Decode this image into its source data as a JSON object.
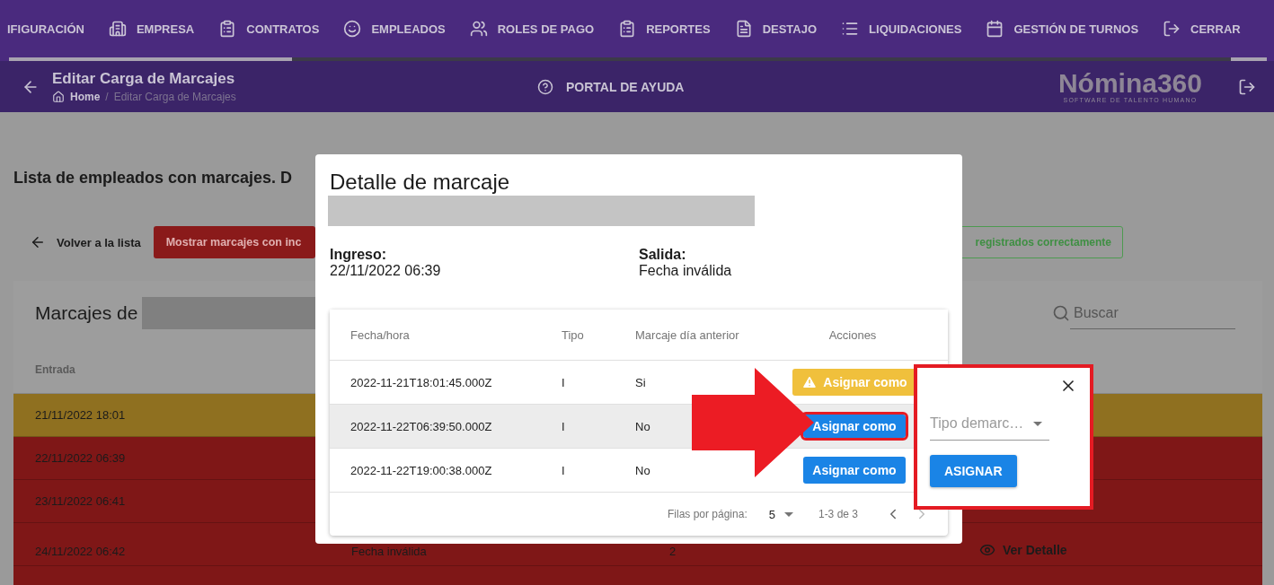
{
  "nav": {
    "items": [
      {
        "label": "IFIGURACIÓN"
      },
      {
        "label": "EMPRESA"
      },
      {
        "label": "CONTRATOS"
      },
      {
        "label": "EMPLEADOS"
      },
      {
        "label": "ROLES DE PAGO"
      },
      {
        "label": "REPORTES"
      },
      {
        "label": "DESTAJO"
      },
      {
        "label": "LIQUIDACIONES"
      },
      {
        "label": "GESTIÓN DE TURNOS"
      },
      {
        "label": "CERRAR"
      }
    ]
  },
  "header": {
    "title": "Editar Carga de Marcajes",
    "breadcrumb": [
      "Home",
      "Editar Carga de Marcajes"
    ],
    "breadcrumb_separator": "/",
    "help": "PORTAL DE AYUDA",
    "logo": "Nómina360",
    "logo_tagline": "SOFTWARE DE TALENTO HUMANO"
  },
  "page": {
    "heading": "Lista de empleados con marcajes. D",
    "back": "Volver a la lista",
    "buttons": [
      {
        "label": "Mostrar marcajes con inc",
        "kind": "filled"
      },
      {
        "label": "registrados correctamente",
        "kind": "outlined"
      }
    ],
    "card": {
      "title": "Marcajes de",
      "search": {
        "placeholder": "Buscar"
      },
      "columns": [
        "Entrada"
      ],
      "rows": [
        {
          "color": "#8f7020",
          "cells": [
            "21/11/2022 18:01"
          ]
        },
        {
          "color": "#7f1717",
          "cells": [
            "22/11/2022 06:39"
          ]
        },
        {
          "color": "#7f1717",
          "cells": [
            "23/11/2022 06:41"
          ]
        },
        {
          "color": "#7f1717",
          "cells": [
            "24/11/2022 06:42",
            "Fecha inválida",
            "2"
          ],
          "action": "Ver Detalle"
        },
        {
          "color": "#7f1717",
          "cells": []
        }
      ]
    }
  },
  "modal": {
    "title": "Detalle de marcaje",
    "ingreso": {
      "label": "Ingreso:",
      "value": "22/11/2022 06:39"
    },
    "salida": {
      "label": "Salida:",
      "value": "Fecha inválida"
    },
    "table": {
      "columns": [
        "Fecha/hora",
        "Tipo",
        "Marcaje día anterior",
        "Acciones"
      ],
      "rows": [
        {
          "fecha": "2022-11-21T18:01:45.000Z",
          "tipo": "I",
          "anterior": "Si",
          "action": {
            "label": "Asignar como",
            "kind": "warning",
            "highlighted": false
          },
          "selected": false
        },
        {
          "fecha": "2022-11-22T06:39:50.000Z",
          "tipo": "I",
          "anterior": "No",
          "action": {
            "label": "Asignar como",
            "kind": "normal",
            "highlighted": true
          },
          "selected": true
        },
        {
          "fecha": "2022-11-22T19:00:38.000Z",
          "tipo": "I",
          "anterior": "No",
          "action": {
            "label": "Asignar como",
            "kind": "normal",
            "highlighted": false
          },
          "selected": false
        }
      ],
      "footer": {
        "rows_label": "Filas por página:",
        "rows_value": "5",
        "range": "1-3 de 3"
      }
    }
  },
  "popover": {
    "select_label": "Tipo demarc…",
    "button": "ASIGNAR"
  }
}
